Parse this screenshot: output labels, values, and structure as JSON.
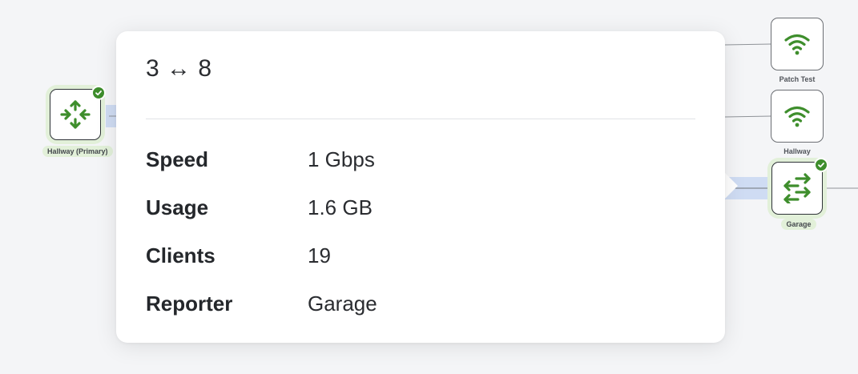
{
  "topology": {
    "nodes": {
      "hallway_primary": {
        "label": "Hallway (Primary)",
        "type": "gateway",
        "status": "online"
      },
      "patch_test": {
        "label": "Patch Test",
        "type": "access-point"
      },
      "hallway": {
        "label": "Hallway",
        "type": "access-point"
      },
      "garage": {
        "label": "Garage",
        "type": "switch",
        "status": "online"
      }
    },
    "colors": {
      "icon_green": "#3e8e2c",
      "selected_glow": "#e2f0d9",
      "active_link": "#cfdcf3"
    }
  },
  "tooltip": {
    "title": "3 ↔ 8",
    "rows": [
      {
        "key": "Speed",
        "value": "1 Gbps"
      },
      {
        "key": "Usage",
        "value": "1.6 GB"
      },
      {
        "key": "Clients",
        "value": "19"
      },
      {
        "key": "Reporter",
        "value": "Garage"
      }
    ]
  }
}
